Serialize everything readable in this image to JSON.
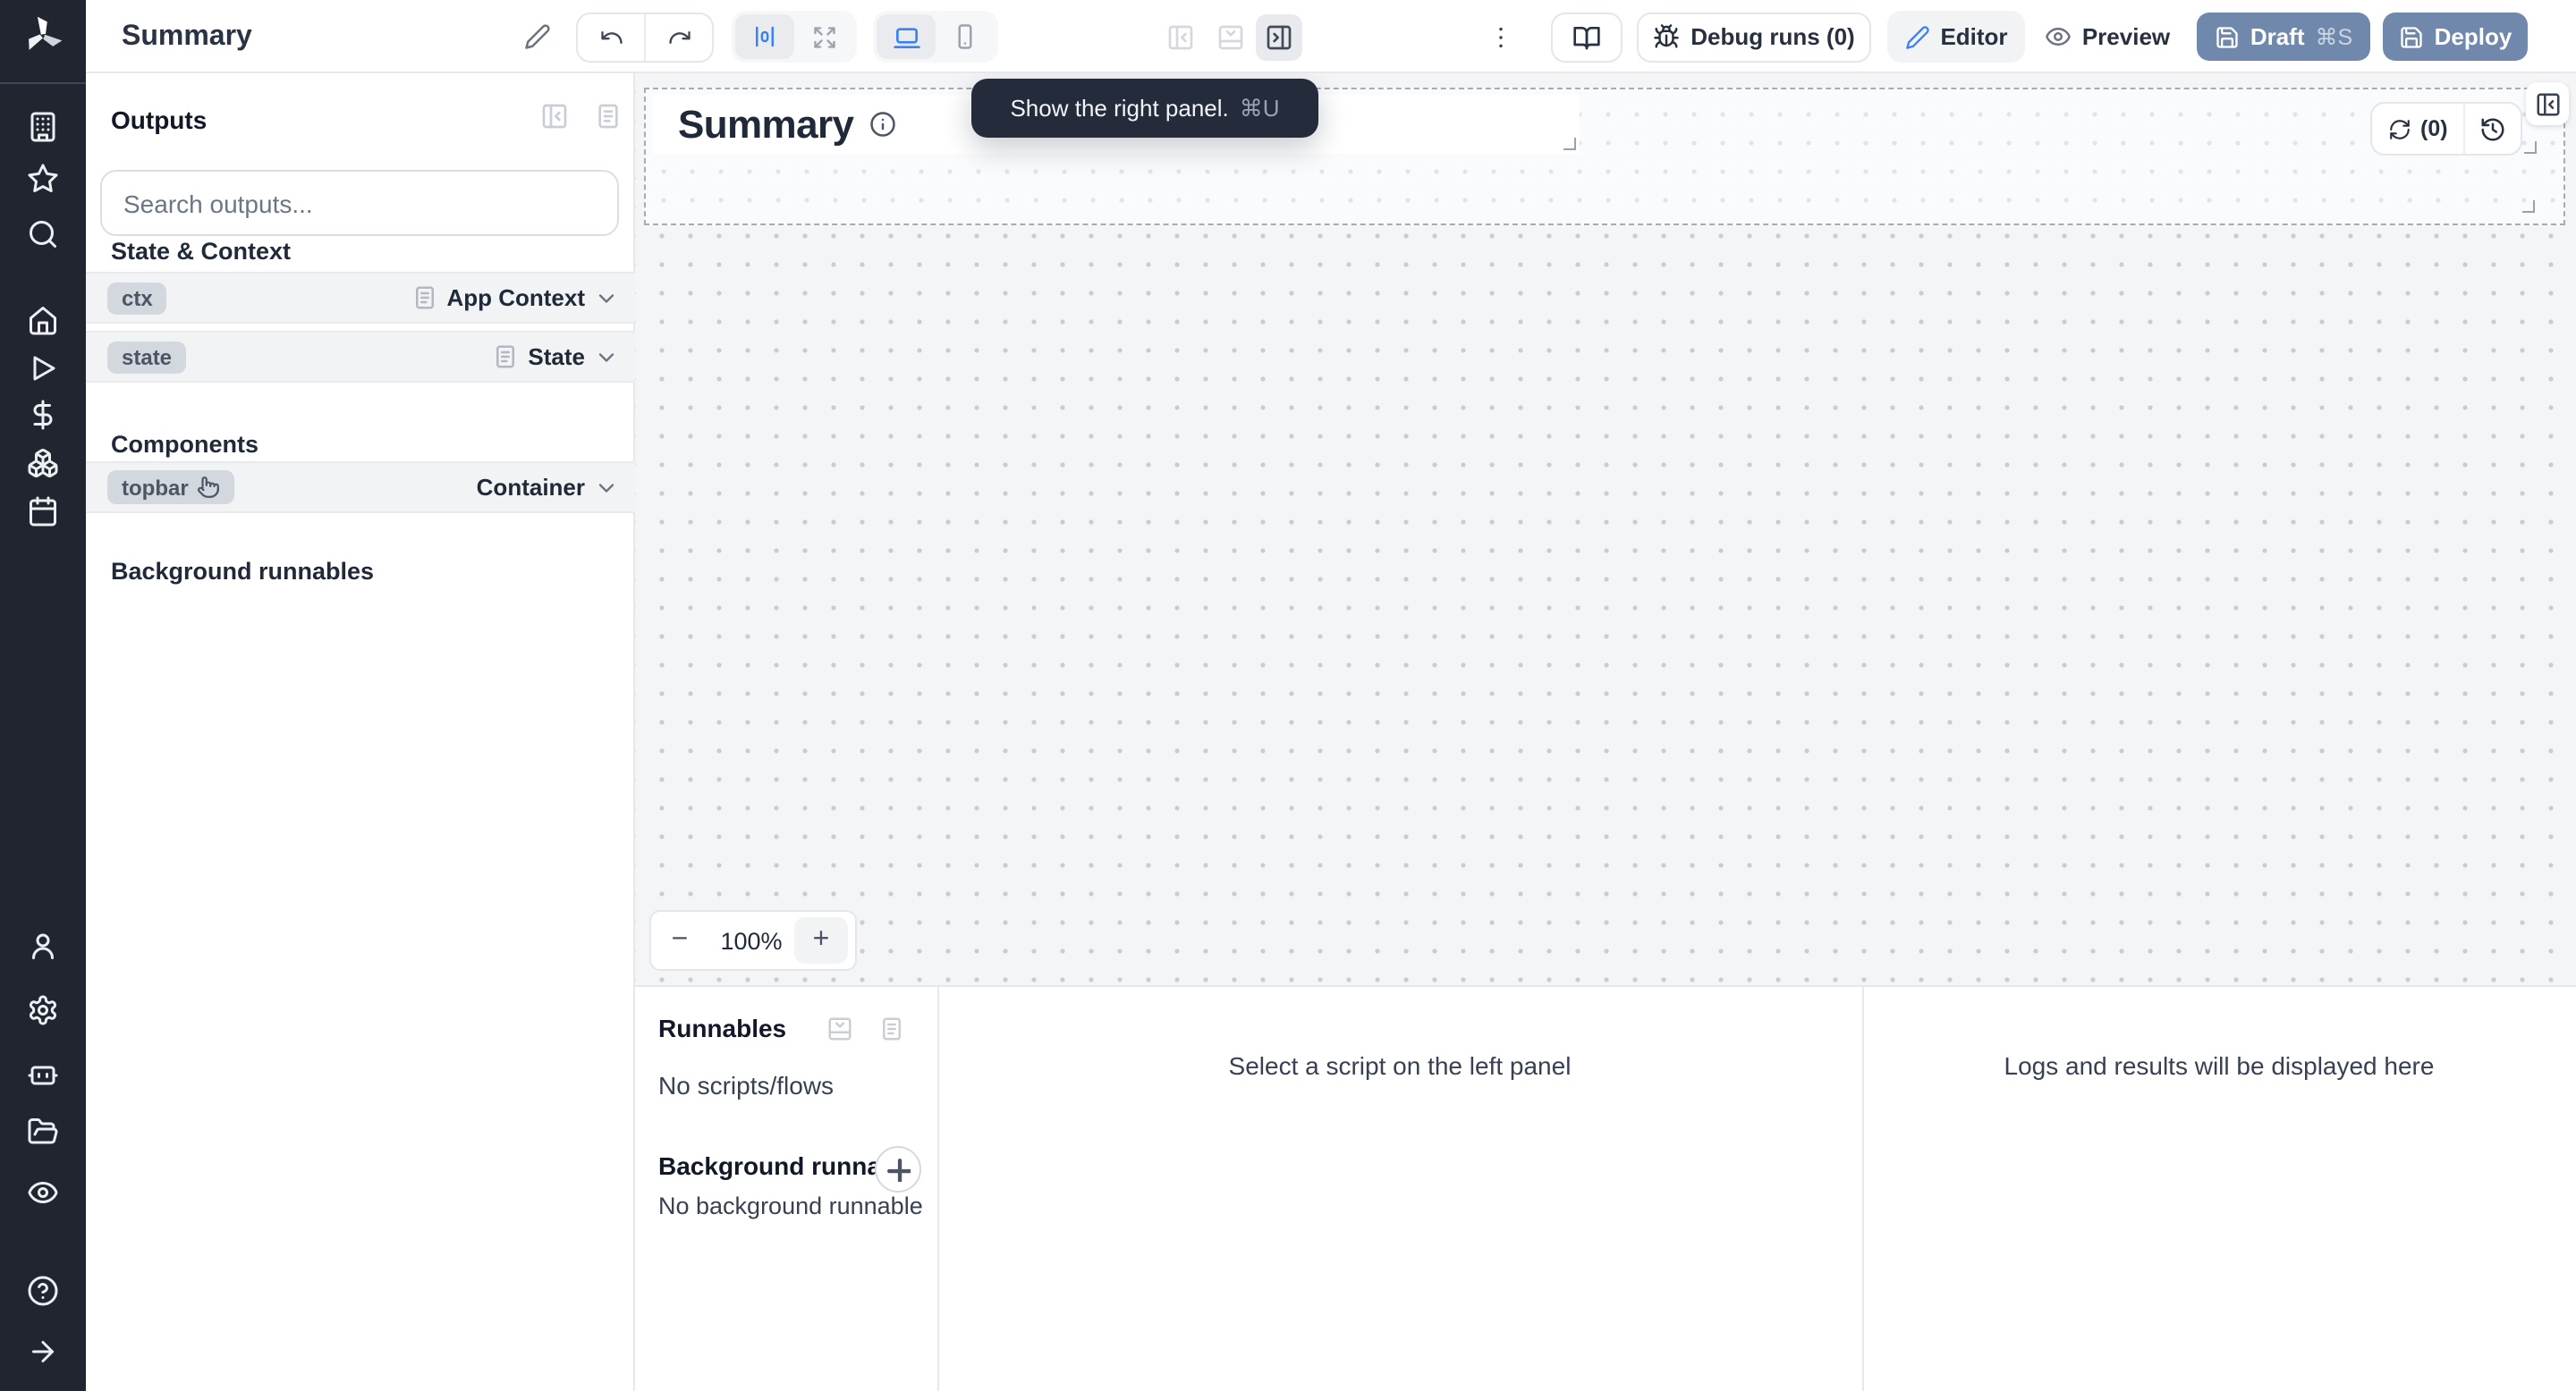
{
  "header": {
    "title": "Summary",
    "debug_runs_label": "Debug runs (0)",
    "editor_label": "Editor",
    "preview_label": "Preview",
    "draft_label": "Draft",
    "draft_shortcut": "⌘S",
    "deploy_label": "Deploy"
  },
  "tooltip": {
    "text": "Show the right panel.",
    "shortcut": "⌘U"
  },
  "outputs_panel": {
    "title": "Outputs",
    "search_placeholder": "Search outputs...",
    "sections": {
      "state_context": "State & Context",
      "components": "Components",
      "background_runnables": "Background runnables"
    },
    "rows": [
      {
        "badge": "ctx",
        "type": "App Context"
      },
      {
        "badge": "state",
        "type": "State"
      }
    ],
    "component_rows": [
      {
        "badge": "topbar",
        "type": "Container"
      }
    ]
  },
  "canvas": {
    "component_title": "Summary",
    "refresh_count": "(0)",
    "zoom_out": "−",
    "zoom_level": "100%",
    "zoom_in": "+"
  },
  "bottom_panel": {
    "runnables_title": "Runnables",
    "no_scripts": "No scripts/flows",
    "background_title": "Background runna...",
    "no_background": "No background runnable",
    "select_script_message": "Select a script on the left panel",
    "logs_message": "Logs and results will be displayed here"
  },
  "colors": {
    "accent_button": "#6f88ab",
    "editor_icon_blue": "#3b82f6",
    "sidebar_bg": "#20252f",
    "tooltip_bg": "#242c3b",
    "canvas_bg": "#f4f5f7"
  },
  "icons": {
    "sidebar": [
      "windmill-logo",
      "building-icon",
      "star-icon",
      "search-icon",
      "home-icon",
      "play-icon",
      "dollar-icon",
      "boxes-icon",
      "calendar-icon",
      "user-icon",
      "gear-icon",
      "bot-icon",
      "folder-open-icon",
      "eye-icon",
      "help-icon",
      "arrow-right-icon"
    ],
    "header": [
      "pencil-icon",
      "undo-icon",
      "redo-icon",
      "align-center-icon",
      "expand-icon",
      "monitor-icon",
      "smartphone-icon",
      "panel-left-icon",
      "panel-bottom-icon",
      "panel-right-icon",
      "kebab-icon",
      "book-open-icon",
      "bug-icon",
      "eye-icon",
      "save-icon"
    ],
    "misc": [
      "document-icon",
      "chevron-down-icon",
      "hand-pointer-cursor-icon",
      "info-icon",
      "refresh-icon",
      "history-icon",
      "plus-icon",
      "panel-collapse-icon"
    ]
  }
}
